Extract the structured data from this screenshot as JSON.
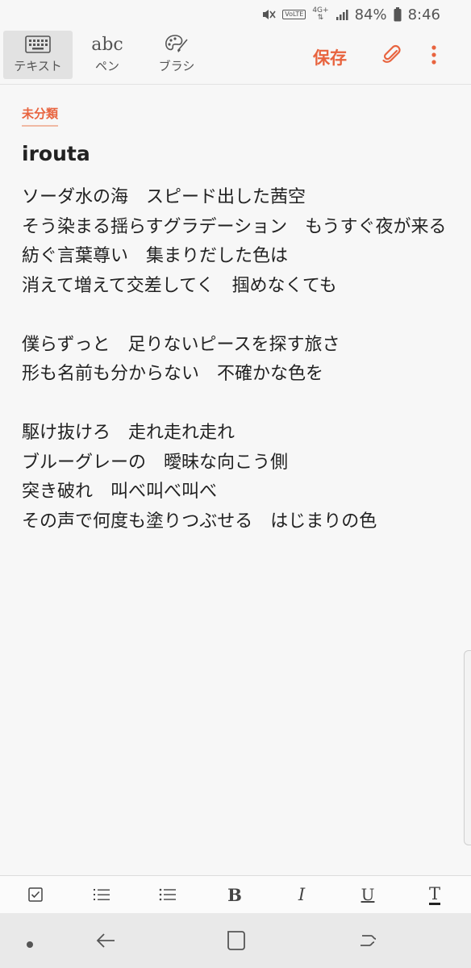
{
  "status_bar": {
    "volte": "VoLTE",
    "network": "4G+",
    "battery": "84%",
    "time": "8:46"
  },
  "toolbar": {
    "tabs": [
      {
        "label": "テキスト",
        "icon": "keyboard-icon",
        "active": true
      },
      {
        "label": "ペン",
        "icon": "abc-handwriting-icon",
        "glyph": "abc",
        "active": false
      },
      {
        "label": "ブラシ",
        "icon": "palette-icon",
        "active": false
      }
    ],
    "save_label": "保存"
  },
  "note": {
    "category": "未分類",
    "title": "irouta",
    "body": "ソーダ水の海　スピード出した茜空\nそう染まる揺らすグラデーション　もうすぐ夜が来る\n紡ぐ言葉尊い　集まりだした色は\n消えて増えて交差してく　掴めなくても\n\n僕らずっと　足りないピースを探す旅さ\n形も名前も分からない　不確かな色を\n\n駆け抜けろ　走れ走れ走れ\nブルーグレーの　曖昧な向こう側\n突き破れ　叫べ叫べ叫べ\nその声で何度も塗りつぶせる　はじまりの色"
  },
  "format_bar": {
    "bold": "B",
    "italic": "I",
    "underline": "U",
    "text_style": "T"
  },
  "colors": {
    "accent": "#e8643f",
    "background": "#f7f7f7"
  }
}
